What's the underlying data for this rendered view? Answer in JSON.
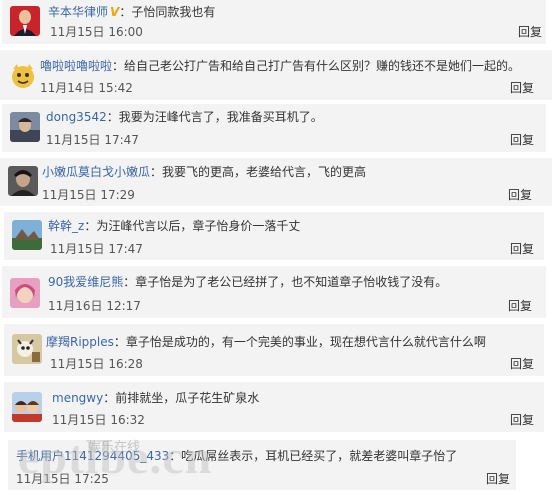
{
  "comments": [
    {
      "user": "辛本华律师",
      "badge": "V",
      "text": "：子怡同款我也有",
      "time": "11月15日 16:00",
      "reply": "回复"
    },
    {
      "user": "嚕啦啦嚕啦啦",
      "badge": "",
      "text": "：给自己老公打广告和给自己打广告有什么区别？赚的钱还不是她们一起的。",
      "time": "11月14日 15:42",
      "reply": "回复"
    },
    {
      "user": "dong3542",
      "badge": "",
      "text": "：我要为汪峰代言了，我准备买耳机了。",
      "time": "11月15日 17:47",
      "reply": "回复"
    },
    {
      "user": "小嫩瓜莫白戈小嫩瓜",
      "badge": "",
      "text": "：我要飞的更高，老婆给代言，飞的更高",
      "time": "11月15日 17:29",
      "reply": "回复"
    },
    {
      "user": "幹幹_z",
      "badge": "",
      "text": "：为汪峰代言以后，章子怡身价一落千丈",
      "time": "11月15日 17:47",
      "reply": "回复"
    },
    {
      "user": "90我爱维尼熊",
      "badge": "",
      "text": "：章子怡是为了老公已经拼了，也不知道章子怡收钱了没有。",
      "time": "11月16日 12:17",
      "reply": "回复"
    },
    {
      "user": "摩羯Ripples",
      "badge": "",
      "text": "：章子怡是成功的，有一个完美的事业，现在想代言什么就代言什么啊",
      "time": "11月15日 16:28",
      "reply": "回复"
    },
    {
      "user": "mengwy",
      "badge": "",
      "text": "：前排就坐，瓜子花生矿泉水",
      "time": "11月15日 16:32",
      "reply": "回复"
    },
    {
      "user": "手机用户1141294405_433",
      "badge": "",
      "text": "：吃瓜屌丝表示，耳机已经买了，就差老婆叫章子怡了",
      "time": "11月15日 17:25",
      "reply": "回复"
    }
  ],
  "watermark": {
    "text": "eptlbe.cn",
    "sub": "娱乐在线"
  }
}
